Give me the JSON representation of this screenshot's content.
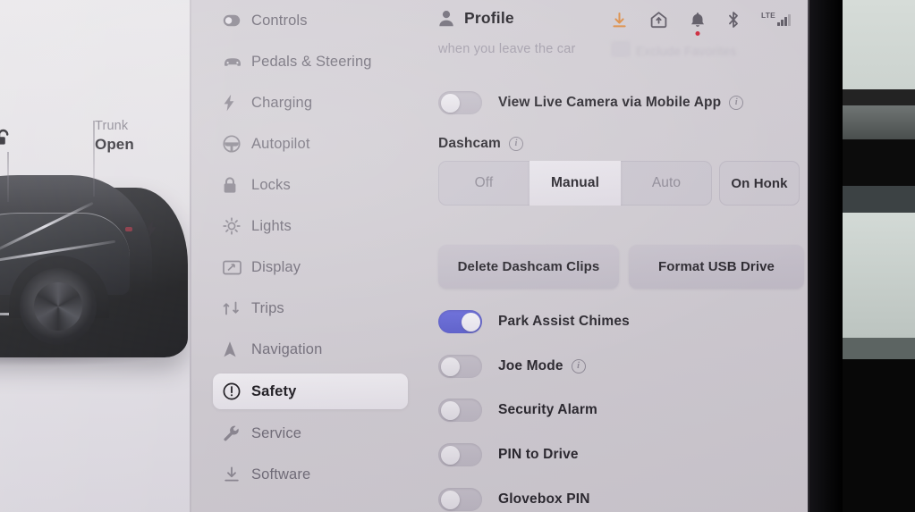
{
  "screen": {
    "background_color": "#d3cfd5",
    "accent_color": "#5357cf",
    "notification_dot_color": "#d0182c",
    "download_icon_color": "#e08a3c"
  },
  "car_panel": {
    "callout_label": "Trunk",
    "callout_value": "Open",
    "lock_icon": "unlock-open-icon",
    "charge_icon": "lightning-bolt-icon",
    "vehicle_icon": "tesla-car-side-view"
  },
  "sidebar": {
    "selected": "Safety",
    "items": [
      {
        "label": "Controls",
        "icon": "toggle-switch-icon"
      },
      {
        "label": "Pedals & Steering",
        "icon": "car-front-icon"
      },
      {
        "label": "Charging",
        "icon": "lightning-bolt-icon"
      },
      {
        "label": "Autopilot",
        "icon": "steering-wheel-icon"
      },
      {
        "label": "Locks",
        "icon": "padlock-closed-icon"
      },
      {
        "label": "Lights",
        "icon": "sun-brightness-icon"
      },
      {
        "label": "Display",
        "icon": "display-screen-icon"
      },
      {
        "label": "Trips",
        "icon": "trips-route-icon"
      },
      {
        "label": "Navigation",
        "icon": "navigation-arrow-icon"
      },
      {
        "label": "Safety",
        "icon": "exclamation-circle-icon"
      },
      {
        "label": "Service",
        "icon": "wrench-icon"
      },
      {
        "label": "Software",
        "icon": "download-tray-icon"
      }
    ]
  },
  "header": {
    "profile_label": "Profile",
    "profile_icon": "person-icon",
    "status_icons": [
      {
        "name": "download-arrow-icon",
        "badge": false
      },
      {
        "name": "home-link-icon",
        "badge": false
      },
      {
        "name": "bell-icon",
        "badge": true
      },
      {
        "name": "bluetooth-icon",
        "badge": false
      },
      {
        "name": "lte-signal-icon",
        "badge": false,
        "text": "LTE"
      }
    ]
  },
  "content": {
    "scrolled_partial_text": "when you leave the car",
    "scrolled_partial_text_right": "Exclude Favorites",
    "live_camera": {
      "label": "View Live Camera via Mobile App",
      "state": "off",
      "has_info": true
    },
    "dashcam": {
      "section_label": "Dashcam",
      "has_info": true,
      "options": [
        "Off",
        "Manual",
        "Auto"
      ],
      "selected": "Manual",
      "extra_option": "On Honk"
    },
    "actions": [
      {
        "label": "Delete Dashcam Clips"
      },
      {
        "label": "Format USB Drive"
      }
    ],
    "toggles": [
      {
        "label": "Park Assist Chimes",
        "state": "on",
        "has_info": false
      },
      {
        "label": "Joe Mode",
        "state": "off",
        "has_info": true
      },
      {
        "label": "Security Alarm",
        "state": "off",
        "has_info": false
      },
      {
        "label": "PIN to Drive",
        "state": "off",
        "has_info": false
      },
      {
        "label": "Glovebox PIN",
        "state": "off",
        "has_info": false
      }
    ]
  }
}
